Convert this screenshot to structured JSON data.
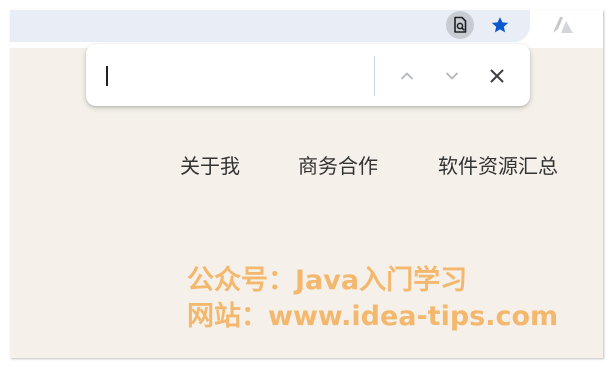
{
  "browser": {
    "find_icon": "find-in-page-icon",
    "star_icon": "bookmark-star-icon",
    "extension_icon": "extension-logo-icon",
    "accent_color": "#0b57d0"
  },
  "find_bar": {
    "value": "",
    "prev_icon": "chevron-up-icon",
    "next_icon": "chevron-down-icon",
    "close_icon": "close-icon"
  },
  "nav": {
    "items": [
      {
        "label": "关于我"
      },
      {
        "label": "商务合作"
      },
      {
        "label": "软件资源汇总"
      }
    ]
  },
  "watermark": {
    "line1": "公众号：Java入门学习",
    "line2": "网站：www.idea-tips.com",
    "color": "#f3b86d"
  }
}
